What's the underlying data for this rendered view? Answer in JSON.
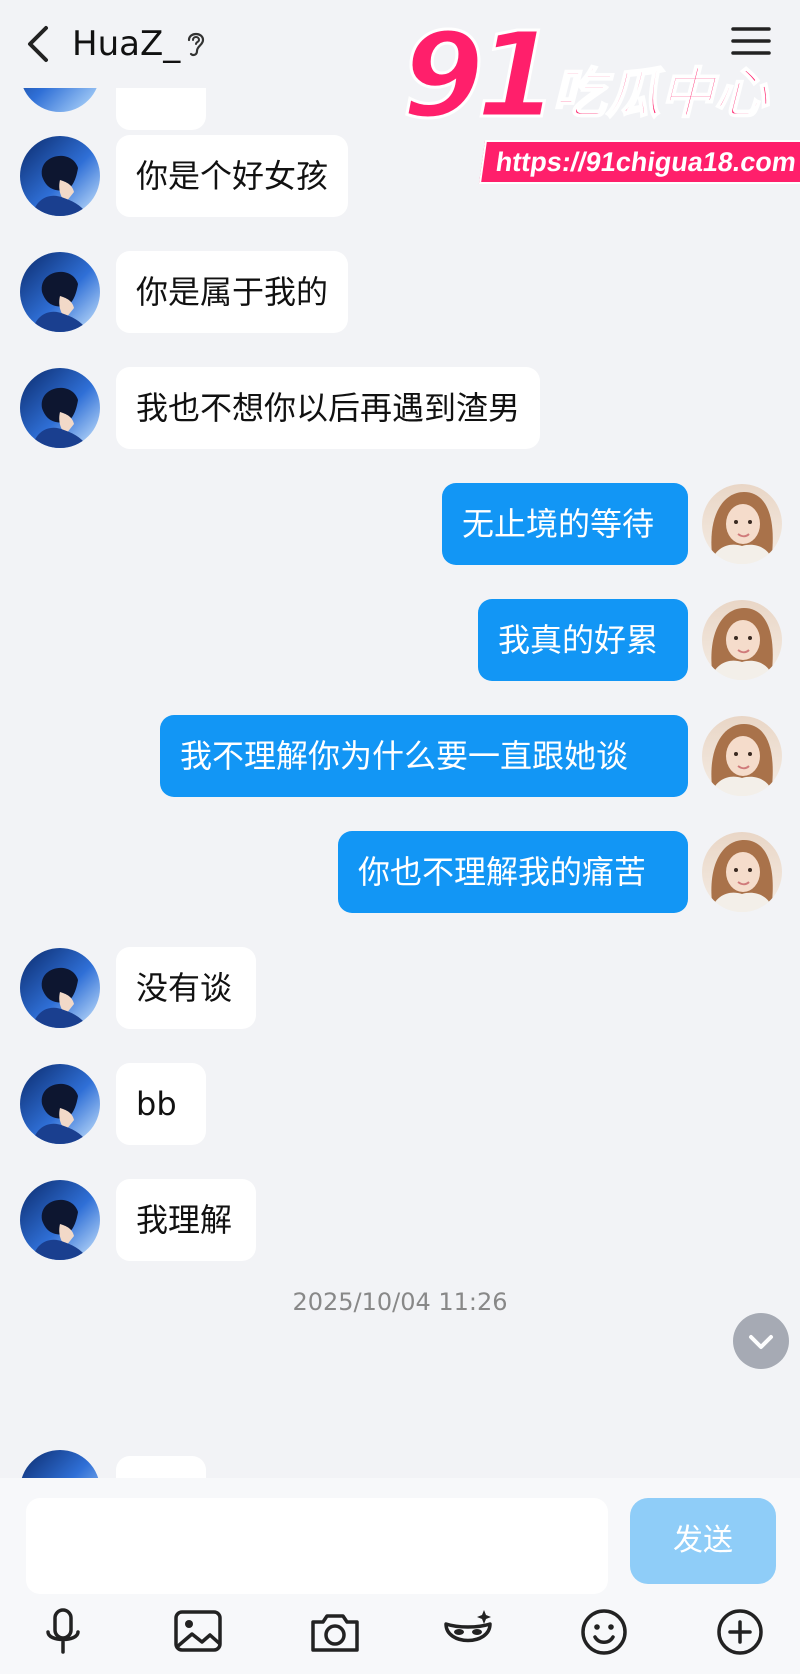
{
  "header": {
    "title": "HuaZ_",
    "icons": {
      "back": "chevron-left-icon",
      "ear": "ear-icon",
      "menu": "menu-icon"
    }
  },
  "watermark": {
    "number": "91",
    "text": "吃瓜中心",
    "url": "https://91chigua18.com",
    "color": "#ff1f6b"
  },
  "messages": [
    {
      "side": "in",
      "text": "你是个好女孩"
    },
    {
      "side": "in",
      "text": "你是属于我的"
    },
    {
      "side": "in",
      "text": "我也不想你以后再遇到渣男"
    },
    {
      "side": "out",
      "text": "无止境的等待"
    },
    {
      "side": "out",
      "text": "我真的好累"
    },
    {
      "side": "out",
      "text": "我不理解你为什么要一直跟她谈"
    },
    {
      "side": "out",
      "text": "你也不理解我的痛苦"
    },
    {
      "side": "in",
      "text": "没有谈"
    },
    {
      "side": "in",
      "text": "bb"
    },
    {
      "side": "in",
      "text": "我理解"
    }
  ],
  "timestamp": "2025/10/04 11:26",
  "input": {
    "placeholder": "",
    "send_label": "发送"
  },
  "toolbar": {
    "items": [
      "mic-icon",
      "image-icon",
      "camera-icon",
      "disguise-mask-icon",
      "emoji-icon",
      "plus-icon"
    ]
  },
  "colors": {
    "outgoing_bubble": "#1296f5",
    "incoming_bubble": "#ffffff",
    "send_button": "#8fcdf8",
    "background": "#f2f3f6"
  }
}
